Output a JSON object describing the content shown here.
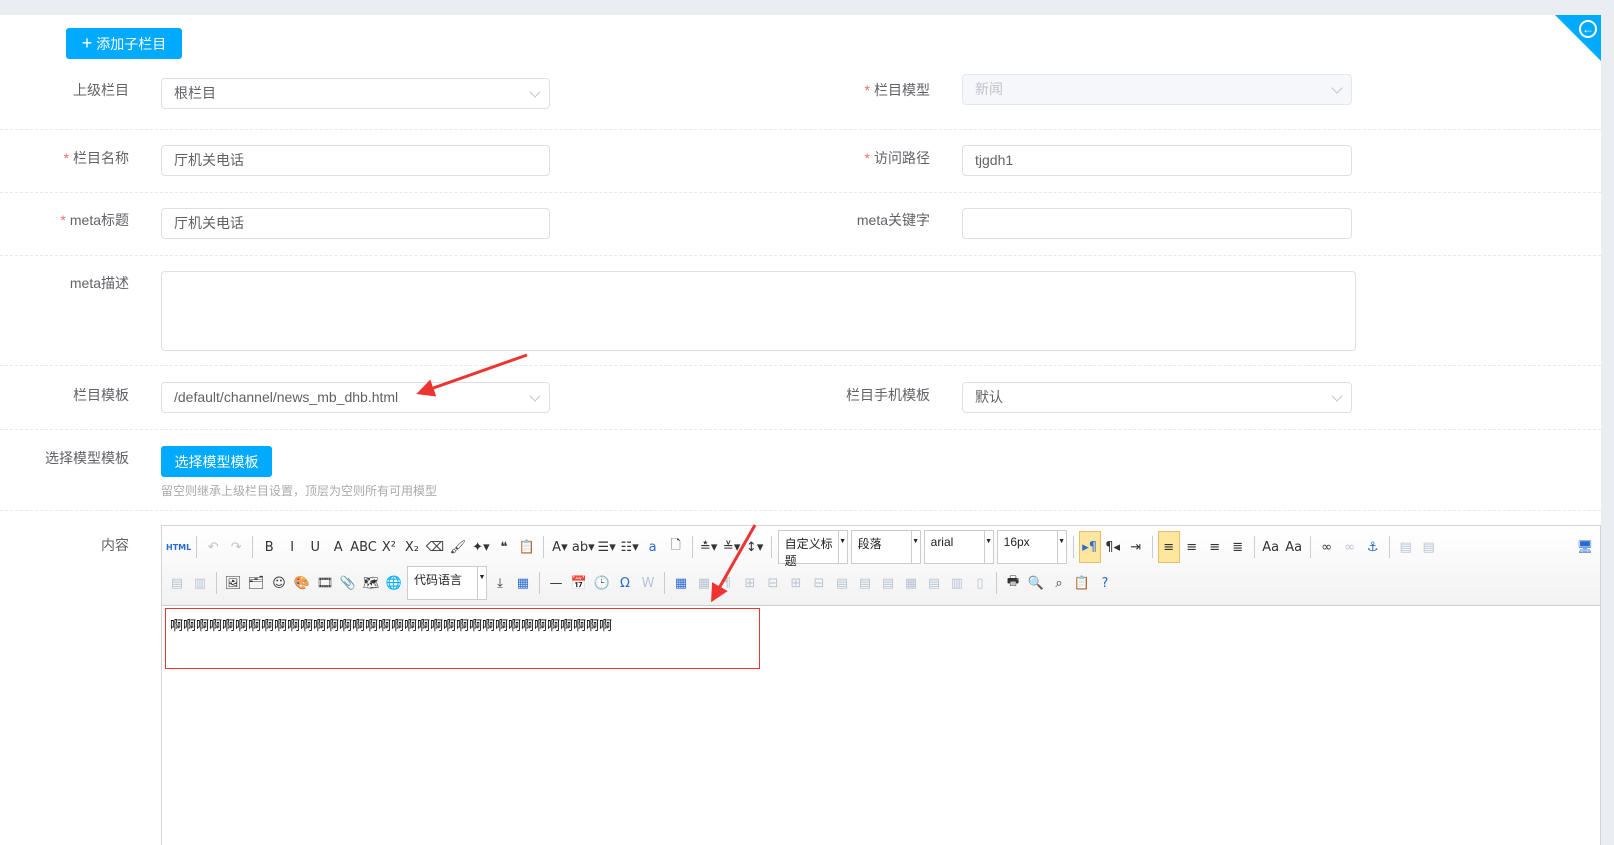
{
  "add_child_button": "添加子栏目",
  "fields": {
    "parent": {
      "label": "上级栏目",
      "value": "根栏目"
    },
    "model": {
      "label": "栏目模型",
      "value": "新闻"
    },
    "name": {
      "label": "栏目名称",
      "value": "厅机关电话"
    },
    "path": {
      "label": "访问路径",
      "value": "tjgdh1"
    },
    "meta_title": {
      "label": "meta标题",
      "value": "厅机关电话"
    },
    "meta_keywords": {
      "label": "meta关键字",
      "value": ""
    },
    "meta_desc": {
      "label": "meta描述",
      "value": ""
    },
    "template": {
      "label": "栏目模板",
      "value": "/default/channel/news_mb_dhb.html"
    },
    "mobile_template": {
      "label": "栏目手机模板",
      "value": "默认"
    },
    "model_template": {
      "label": "选择模型模板",
      "button": "选择模型模板",
      "hint": "留空则继承上级栏目设置，顶层为空则所有可用模型"
    },
    "content": {
      "label": "内容",
      "value": "啊啊啊啊啊啊啊啊啊啊啊啊啊啊啊啊啊啊啊啊啊啊啊啊啊啊啊啊啊啊啊啊啊啊"
    }
  },
  "toolbar": {
    "heading_select": "自定义标题",
    "paragraph_select": "段落",
    "font_select": "arial",
    "size_select": "16px",
    "code_select": "代码语言"
  },
  "colors": {
    "accent": "#00aaff",
    "required": "#f56c6c",
    "annotation": "#ee3333"
  }
}
